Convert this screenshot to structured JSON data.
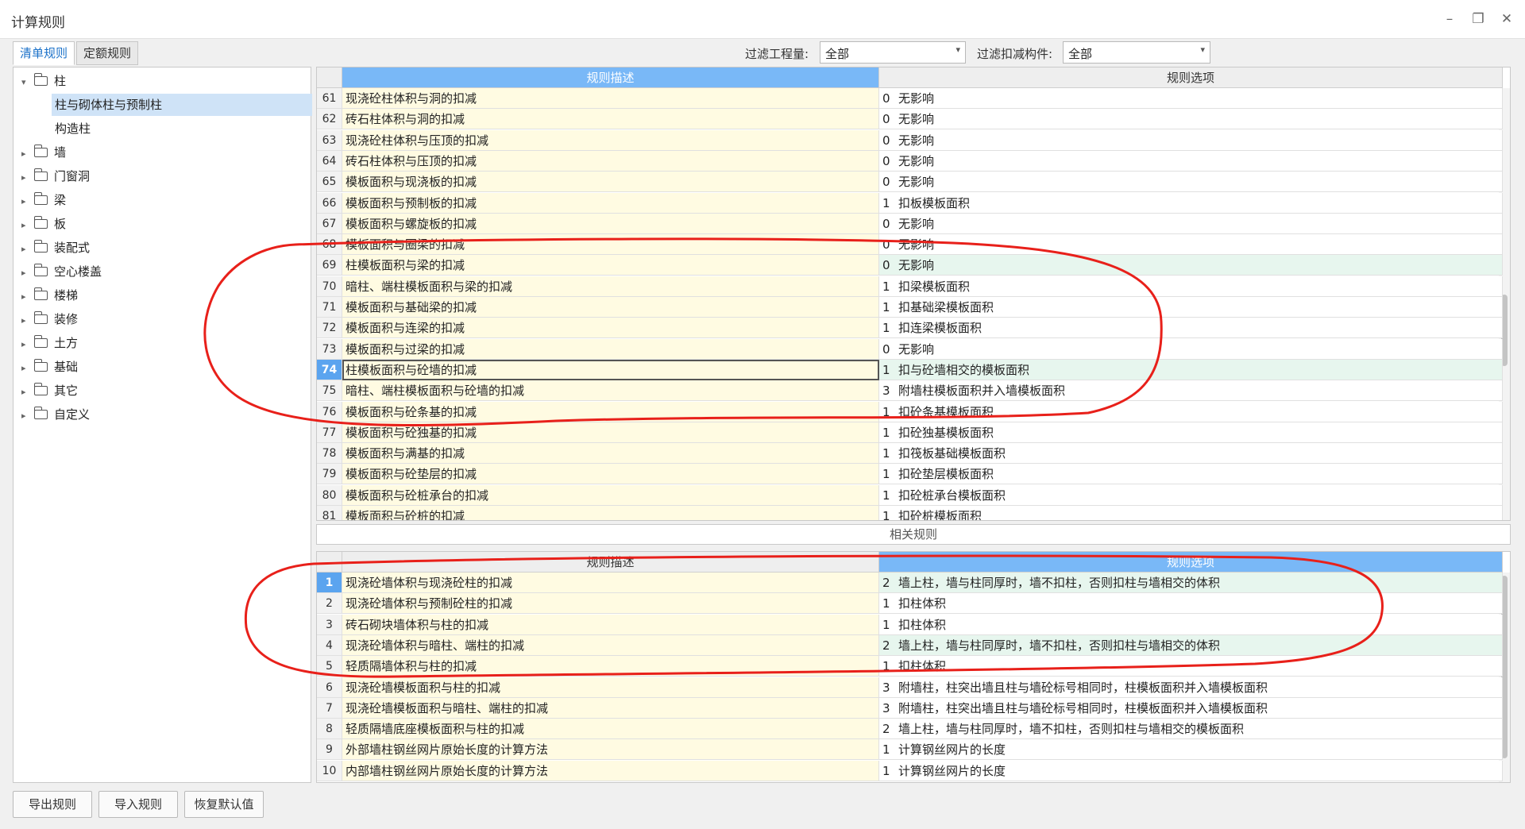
{
  "window": {
    "title": "计算规则",
    "minimize": "–",
    "restore": "❐",
    "close": "✕"
  },
  "tabs": [
    {
      "label": "清单规则"
    },
    {
      "label": "定额规则"
    }
  ],
  "filters": {
    "quantity_label": "过滤工程量:",
    "quantity_value": "全部",
    "component_label": "过滤扣减构件:",
    "component_value": "全部"
  },
  "tree": [
    {
      "label": "柱",
      "expanded": true
    },
    {
      "label": "柱与砌体柱与预制柱",
      "child": true,
      "selected": true
    },
    {
      "label": "构造柱",
      "child": true
    },
    {
      "label": "墙"
    },
    {
      "label": "门窗洞"
    },
    {
      "label": "梁"
    },
    {
      "label": "板"
    },
    {
      "label": "装配式"
    },
    {
      "label": "空心楼盖"
    },
    {
      "label": "楼梯"
    },
    {
      "label": "装修"
    },
    {
      "label": "土方"
    },
    {
      "label": "基础"
    },
    {
      "label": "其它"
    },
    {
      "label": "自定义"
    }
  ],
  "main_grid": {
    "headers": {
      "desc": "规则描述",
      "opt": "规则选项"
    },
    "rows": [
      {
        "n": "61",
        "desc": "现浇砼柱体积与洞的扣减",
        "code": "0",
        "opt": "无影响"
      },
      {
        "n": "62",
        "desc": "砖石柱体积与洞的扣减",
        "code": "0",
        "opt": "无影响"
      },
      {
        "n": "63",
        "desc": "现浇砼柱体积与压顶的扣减",
        "code": "0",
        "opt": "无影响"
      },
      {
        "n": "64",
        "desc": "砖石柱体积与压顶的扣减",
        "code": "0",
        "opt": "无影响"
      },
      {
        "n": "65",
        "desc": "模板面积与现浇板的扣减",
        "code": "0",
        "opt": "无影响"
      },
      {
        "n": "66",
        "desc": "模板面积与预制板的扣减",
        "code": "1",
        "opt": "扣板模板面积"
      },
      {
        "n": "67",
        "desc": "模板面积与螺旋板的扣减",
        "code": "0",
        "opt": "无影响"
      },
      {
        "n": "68",
        "desc": "模板面积与圈梁的扣减",
        "code": "0",
        "opt": "无影响"
      },
      {
        "n": "69",
        "desc": "柱模板面积与梁的扣减",
        "code": "0",
        "opt": "无影响",
        "green": true
      },
      {
        "n": "70",
        "desc": "暗柱、端柱模板面积与梁的扣减",
        "code": "1",
        "opt": "扣梁模板面积"
      },
      {
        "n": "71",
        "desc": "模板面积与基础梁的扣减",
        "code": "1",
        "opt": "扣基础梁模板面积"
      },
      {
        "n": "72",
        "desc": "模板面积与连梁的扣减",
        "code": "1",
        "opt": "扣连梁模板面积"
      },
      {
        "n": "73",
        "desc": "模板面积与过梁的扣减",
        "code": "0",
        "opt": "无影响"
      },
      {
        "n": "74",
        "desc": "柱模板面积与砼墙的扣减",
        "code": "1",
        "opt": "扣与砼墙相交的模板面积",
        "selected": true,
        "green": true
      },
      {
        "n": "75",
        "desc": "暗柱、端柱模板面积与砼墙的扣减",
        "code": "3",
        "opt": "附墙柱模板面积并入墙模板面积"
      },
      {
        "n": "76",
        "desc": "模板面积与砼条基的扣减",
        "code": "1",
        "opt": "扣砼条基模板面积"
      },
      {
        "n": "77",
        "desc": "模板面积与砼独基的扣减",
        "code": "1",
        "opt": "扣砼独基模板面积"
      },
      {
        "n": "78",
        "desc": "模板面积与满基的扣减",
        "code": "1",
        "opt": "扣筏板基础模板面积"
      },
      {
        "n": "79",
        "desc": "模板面积与砼垫层的扣减",
        "code": "1",
        "opt": "扣砼垫层模板面积"
      },
      {
        "n": "80",
        "desc": "模板面积与砼桩承台的扣减",
        "code": "1",
        "opt": "扣砼桩承台模板面积"
      },
      {
        "n": "81",
        "desc": "模板面积与砼桩的扣减",
        "code": "1",
        "opt": "扣砼桩模板面积"
      }
    ]
  },
  "related_title": "相关规则",
  "related_grid": {
    "headers": {
      "desc": "规则描述",
      "opt": "规则选项"
    },
    "rows": [
      {
        "n": "1",
        "desc": "现浇砼墙体积与现浇砼柱的扣减",
        "code": "2",
        "opt": "墙上柱，墙与柱同厚时，墙不扣柱，否则扣柱与墙相交的体积",
        "selected": true,
        "green": true
      },
      {
        "n": "2",
        "desc": "现浇砼墙体积与预制砼柱的扣减",
        "code": "1",
        "opt": "扣柱体积"
      },
      {
        "n": "3",
        "desc": "砖石砌块墙体积与柱的扣减",
        "code": "1",
        "opt": "扣柱体积"
      },
      {
        "n": "4",
        "desc": "现浇砼墙体积与暗柱、端柱的扣减",
        "code": "2",
        "opt": "墙上柱，墙与柱同厚时，墙不扣柱，否则扣柱与墙相交的体积",
        "green": true
      },
      {
        "n": "5",
        "desc": "轻质隔墙体积与柱的扣减",
        "code": "1",
        "opt": "扣柱体积"
      },
      {
        "n": "6",
        "desc": "现浇砼墙模板面积与柱的扣减",
        "code": "3",
        "opt": "附墙柱，柱突出墙且柱与墙砼标号相同时，柱模板面积并入墙模板面积"
      },
      {
        "n": "7",
        "desc": "现浇砼墙模板面积与暗柱、端柱的扣减",
        "code": "3",
        "opt": "附墙柱，柱突出墙且柱与墙砼标号相同时，柱模板面积并入墙模板面积"
      },
      {
        "n": "8",
        "desc": "轻质隔墙底座模板面积与柱的扣减",
        "code": "2",
        "opt": "墙上柱，墙与柱同厚时，墙不扣柱，否则扣柱与墙相交的模板面积"
      },
      {
        "n": "9",
        "desc": "外部墙柱钢丝网片原始长度的计算方法",
        "code": "1",
        "opt": "计算钢丝网片的长度"
      },
      {
        "n": "10",
        "desc": "内部墙柱钢丝网片原始长度的计算方法",
        "code": "1",
        "opt": "计算钢丝网片的长度"
      }
    ]
  },
  "buttons": {
    "export": "导出规则",
    "import": "导入规则",
    "restore": "恢复默认值"
  },
  "annotation_color": "#e8201a"
}
